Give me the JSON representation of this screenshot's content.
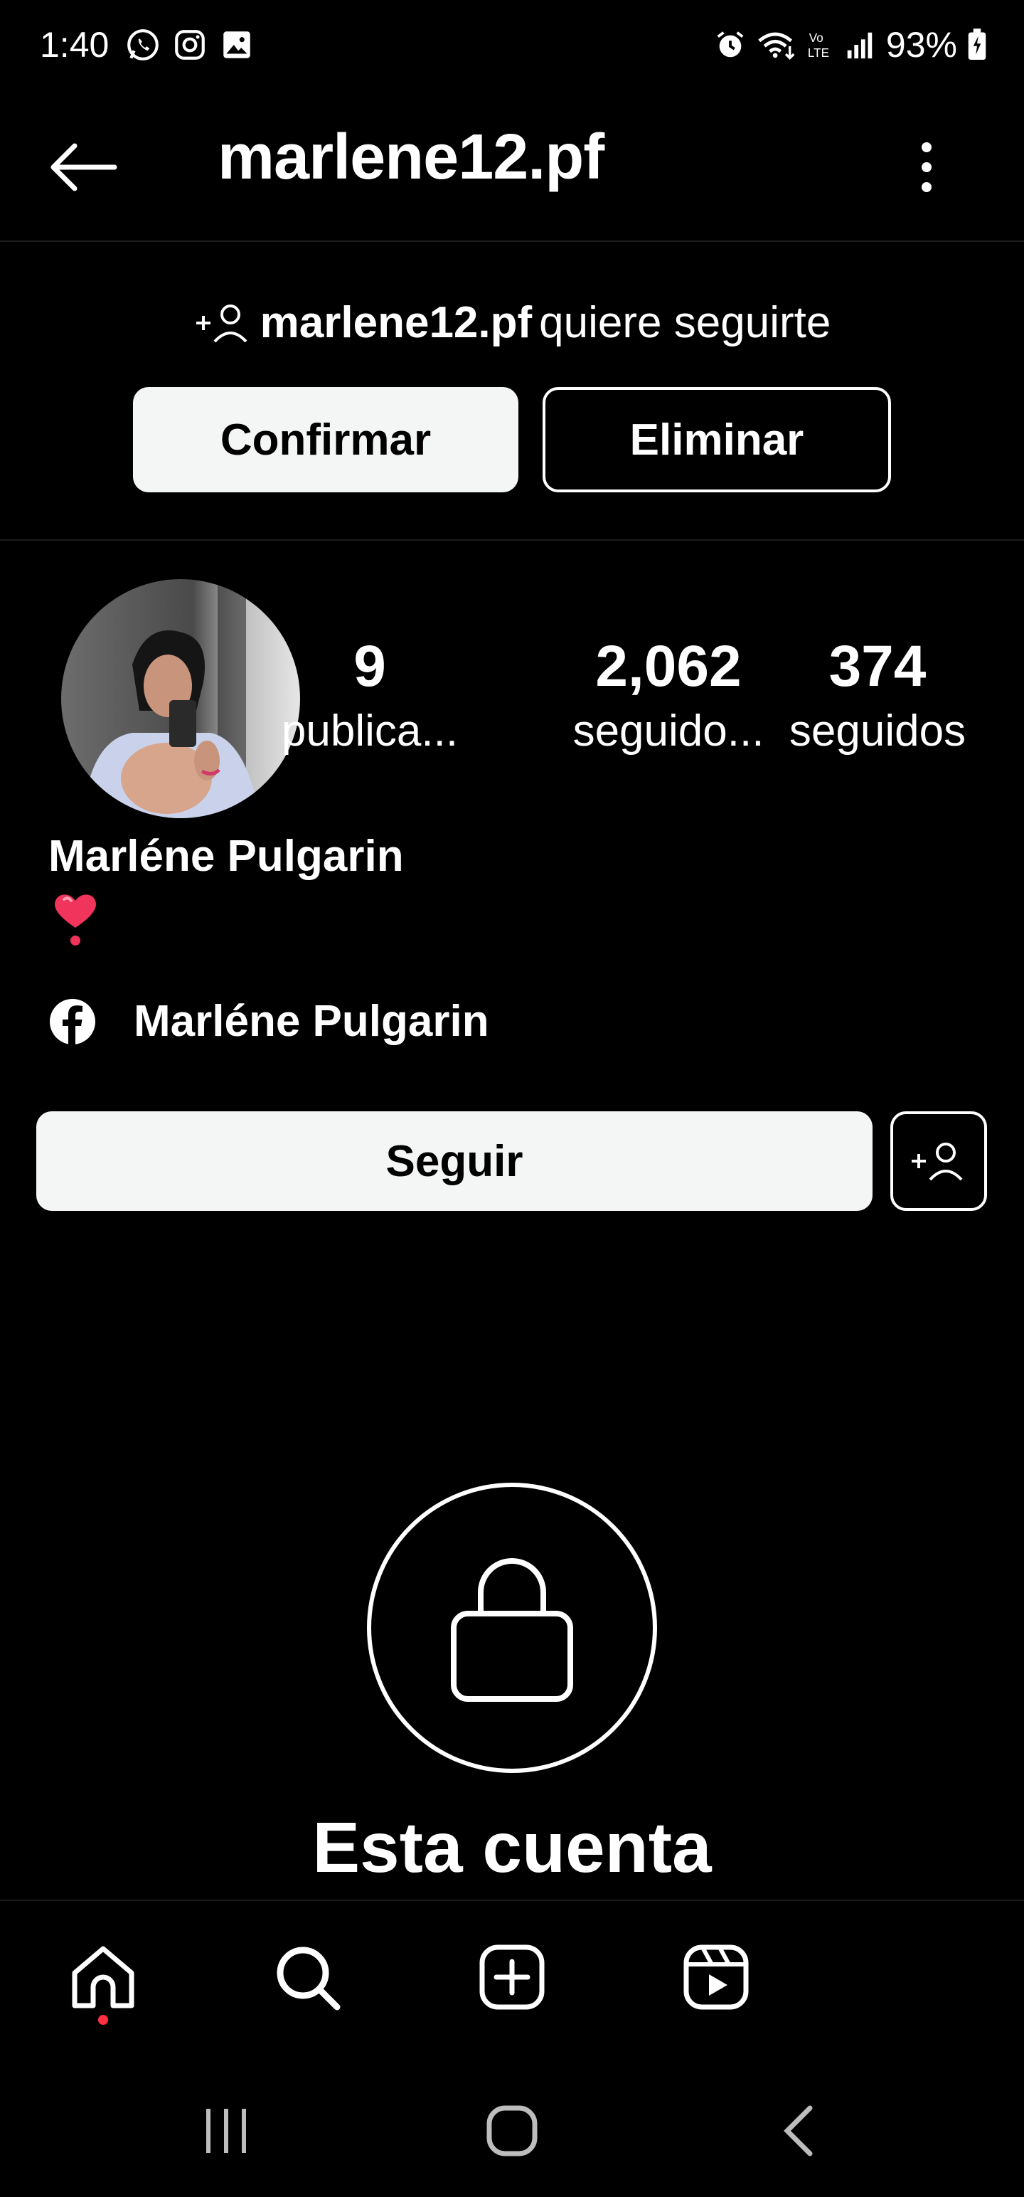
{
  "status_bar": {
    "time": "1:40",
    "left_icons": [
      "whatsapp-icon",
      "instagram-icon",
      "gallery-icon"
    ],
    "right_icons": [
      "alarm-icon",
      "wifi-icon",
      "volte-icon",
      "signal-icon"
    ],
    "battery": "93%"
  },
  "header": {
    "title": "marlene12.pf",
    "back_icon": "arrow-left-icon",
    "menu_icon": "more-vertical-icon"
  },
  "follow_request": {
    "icon": "add-person-icon",
    "username": "marlene12.pf",
    "text": "quiere seguirte",
    "confirm_label": "Confirmar",
    "delete_label": "Eliminar"
  },
  "profile": {
    "stats": [
      {
        "value": "9",
        "label": "publica..."
      },
      {
        "value": "2,062",
        "label": "seguido..."
      },
      {
        "value": "374",
        "label": "seguidos"
      }
    ],
    "name": "Marléne Pulgarin",
    "bio": "❣️",
    "facebook_name": "Marléne Pulgarin",
    "follow_label": "Seguir"
  },
  "private": {
    "title": "Esta cuenta"
  },
  "bottom_nav": [
    "home-icon",
    "search-icon",
    "create-icon",
    "reels-icon"
  ],
  "accent_colors": {
    "notification_dot": "#ff3040",
    "button_light": "#f4f5f5"
  }
}
